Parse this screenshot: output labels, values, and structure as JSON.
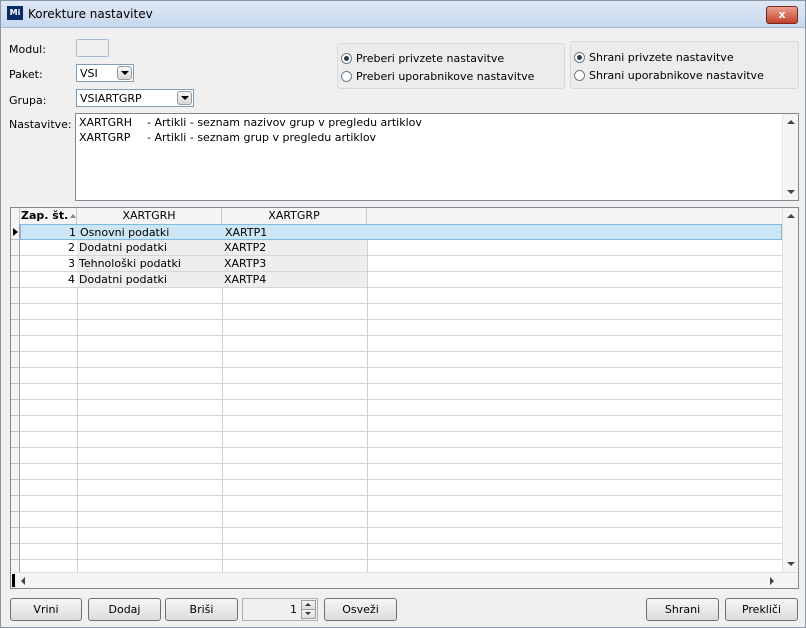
{
  "window": {
    "title": "Korekture nastavitev",
    "icon": "app-logo-icon",
    "close_glyph": "x"
  },
  "form": {
    "modul_label": "Modul:",
    "paket_label": "Paket:",
    "paket_value": "VSI",
    "grupa_label": "Grupa:",
    "grupa_value": "VSIARTGRP",
    "nastavitve_label": "Nastavitve:"
  },
  "read_options": [
    {
      "label": "Preberi privzete nastavitve",
      "selected": true
    },
    {
      "label": "Preberi uporabnikove nastavitve",
      "selected": false
    }
  ],
  "save_options": [
    {
      "label": "Shrani privzete nastavitve",
      "selected": true
    },
    {
      "label": "Shrani uporabnikove nastavitve",
      "selected": false
    }
  ],
  "settings": [
    {
      "key": "XARTGRH",
      "desc": "- Artikli - seznam nazivov grup v pregledu artiklov"
    },
    {
      "key": "XARTGRP",
      "desc": "- Artikli - seznam grup v pregledu artiklov"
    }
  ],
  "grid": {
    "columns": [
      "Zap. št.",
      "XARTGRH",
      "XARTGRP"
    ],
    "rows": [
      {
        "num": "1",
        "grh": "Osnovni podatki",
        "grp": "XARTP1"
      },
      {
        "num": "2",
        "grh": "Dodatni podatki",
        "grp": "XARTP2"
      },
      {
        "num": "3",
        "grh": "Tehnološki podatki",
        "grp": "XARTP3"
      },
      {
        "num": "4",
        "grh": "Dodatni podatki",
        "grp": "XARTP4"
      }
    ],
    "selected_row": 0
  },
  "footer": {
    "vrini": "Vrini",
    "dodaj": "Dodaj",
    "brisi": "Briši",
    "spin_value": "1",
    "osvezi": "Osveži",
    "shrani": "Shrani",
    "preklici": "Prekliči"
  },
  "colors": {
    "selection": "#cde6f5",
    "title_bar": "#c7d8ee"
  }
}
